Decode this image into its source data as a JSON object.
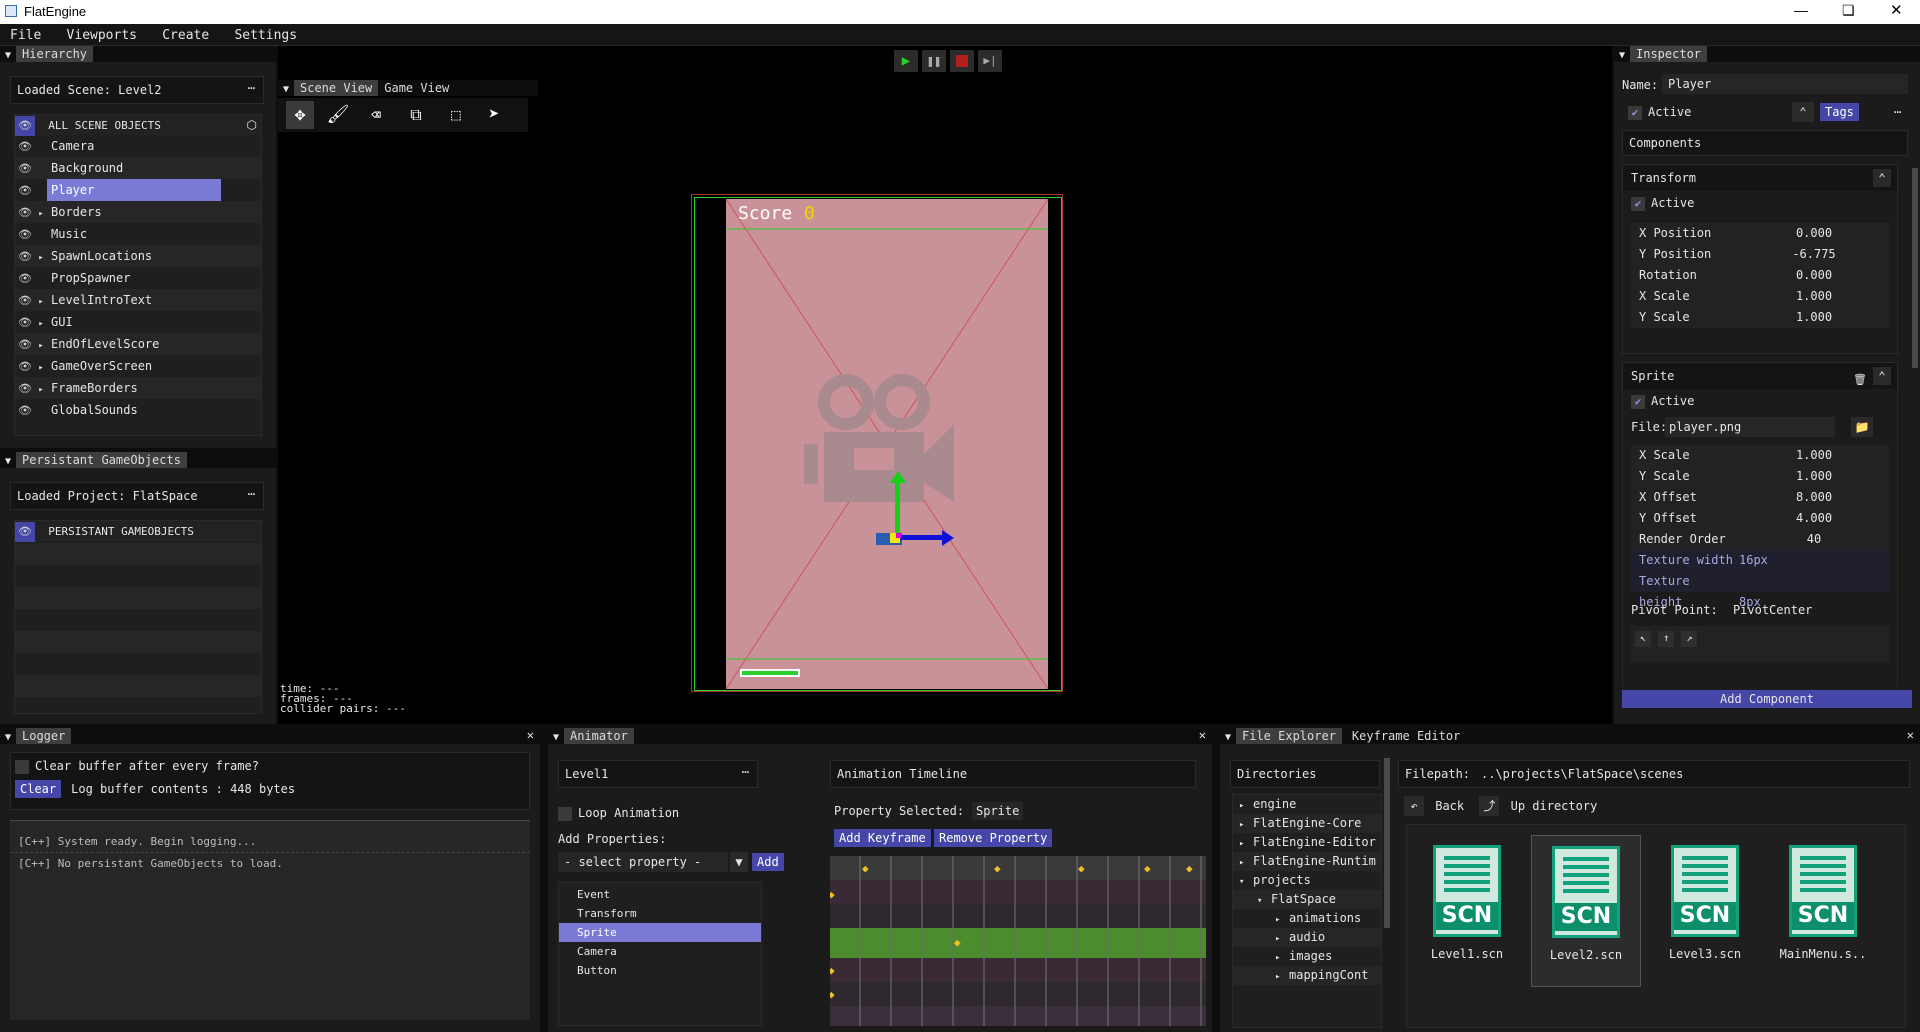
{
  "app": {
    "title": "FlatEngine"
  },
  "menu": {
    "items": [
      "File",
      "Viewports",
      "Create",
      "Settings"
    ]
  },
  "hierarchy": {
    "tab": "Hierarchy",
    "loaded_scene": "Loaded Scene: Level2",
    "header": "ALL SCENE OBJECTS",
    "items": [
      {
        "label": "Camera",
        "expand": ""
      },
      {
        "label": "Background",
        "expand": ""
      },
      {
        "label": "Player",
        "expand": ""
      },
      {
        "label": "Borders",
        "expand": "▸"
      },
      {
        "label": "Music",
        "expand": ""
      },
      {
        "label": "SpawnLocations",
        "expand": "▸"
      },
      {
        "label": "PropSpawner",
        "expand": ""
      },
      {
        "label": "LevelIntroText",
        "expand": "▸"
      },
      {
        "label": "GUI",
        "expand": "▸"
      },
      {
        "label": "EndOfLevelScore",
        "expand": "▸"
      },
      {
        "label": "GameOverScreen",
        "expand": "▸"
      },
      {
        "label": "FrameBorders",
        "expand": "▸"
      },
      {
        "label": "GlobalSounds",
        "expand": ""
      }
    ],
    "selected": "Player"
  },
  "persistant": {
    "tab": "Persistant GameObjects",
    "loaded_project": "Loaded Project: FlatSpace",
    "header": "PERSISTANT GAMEOBJECTS"
  },
  "scene": {
    "tabs": [
      "Scene View",
      "Game View"
    ],
    "score_label": "Score",
    "score_value": "0",
    "stats": [
      "time:  ---",
      "frames: ---",
      "collider pairs: ---"
    ]
  },
  "inspector": {
    "tab": "Inspector",
    "name_label": "Name:",
    "name_value": "Player",
    "active_label": "Active",
    "tags_button": "Tags",
    "components_label": "Components",
    "transform": {
      "title": "Transform",
      "active": "Active",
      "rows": [
        {
          "k": "X Position",
          "v": "0.000"
        },
        {
          "k": "Y Position",
          "v": "-6.775"
        },
        {
          "k": "Rotation",
          "v": "0.000"
        },
        {
          "k": "X Scale",
          "v": "1.000"
        },
        {
          "k": "Y Scale",
          "v": "1.000"
        }
      ]
    },
    "sprite": {
      "title": "Sprite",
      "active": "Active",
      "file_label": "File:",
      "file_value": "player.png",
      "rows": [
        {
          "k": "X Scale",
          "v": "1.000"
        },
        {
          "k": "Y Scale",
          "v": "1.000"
        },
        {
          "k": "X Offset",
          "v": "8.000"
        },
        {
          "k": "Y Offset",
          "v": "4.000"
        },
        {
          "k": "Render Order",
          "v": "40"
        }
      ],
      "tex_rows": [
        {
          "k": "Texture width",
          "v": "16px"
        },
        {
          "k": "Texture height",
          "v": "8px"
        }
      ],
      "pivot_label": "Pivot Point:",
      "pivot_value": "PivotCenter"
    },
    "add_component": "Add Component"
  },
  "logger": {
    "tab": "Logger",
    "clear_every_frame": "Clear buffer after every frame?",
    "clear_btn": "Clear",
    "buffer_info": "Log buffer contents :  448 bytes",
    "lines": [
      "[C++] System ready. Begin logging...",
      "[C++] No persistant GameObjects to load."
    ]
  },
  "animator": {
    "tab": "Animator",
    "animation_name": "Level1",
    "loop_label": "Loop Animation",
    "add_props_label": "Add Properties:",
    "select_placeholder": "- select property -",
    "add_btn": "Add",
    "properties": [
      "Event",
      "Transform",
      "Sprite",
      "Camera",
      "Button"
    ],
    "selected_property": "Sprite",
    "timeline_title": "Animation Timeline",
    "prop_selected_label": "Property Selected:",
    "prop_selected_value": "Sprite",
    "add_keyframe": "Add Keyframe",
    "remove_property": "Remove Property"
  },
  "explorer": {
    "tabs": [
      "File Explorer",
      "Keyframe Editor"
    ],
    "directories_label": "Directories",
    "dirs": [
      {
        "label": "engine",
        "indent": 0,
        "arrow": "▸"
      },
      {
        "label": "FlatEngine-Core",
        "indent": 0,
        "arrow": "▸"
      },
      {
        "label": "FlatEngine-Editor",
        "indent": 0,
        "arrow": "▸"
      },
      {
        "label": "FlatEngine-Runtim",
        "indent": 0,
        "arrow": "▸"
      },
      {
        "label": "projects",
        "indent": 0,
        "arrow": "▾"
      },
      {
        "label": "FlatSpace",
        "indent": 1,
        "arrow": "▾"
      },
      {
        "label": "animations",
        "indent": 2,
        "arrow": "▸"
      },
      {
        "label": "audio",
        "indent": 2,
        "arrow": "▸"
      },
      {
        "label": "images",
        "indent": 2,
        "arrow": "▸"
      },
      {
        "label": "mappingCont",
        "indent": 2,
        "arrow": "▸"
      }
    ],
    "filepath_label": "Filepath:",
    "filepath_value": "..\\projects\\FlatSpace\\scenes",
    "back_label": "Back",
    "up_label": "Up directory",
    "files": [
      {
        "name": "Level1.scn",
        "icon": "SCN"
      },
      {
        "name": "Level2.scn",
        "icon": "SCN"
      },
      {
        "name": "Level3.scn",
        "icon": "SCN"
      },
      {
        "name": "MainMenu.s..",
        "icon": "SCN"
      }
    ]
  },
  "colors": {
    "accent": "#4646a8",
    "selection": "#7b7bd6",
    "file_green": "#12a17a",
    "scene_bg": "#c89298"
  }
}
